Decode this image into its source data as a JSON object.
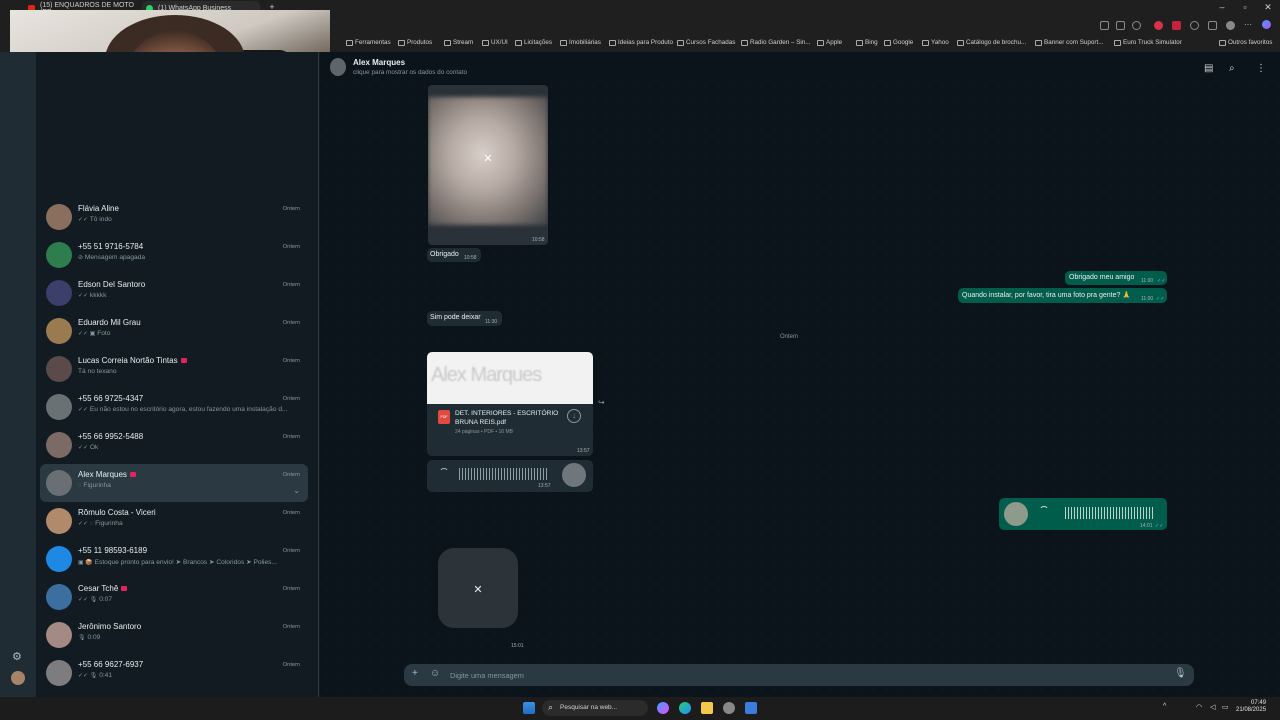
{
  "browser": {
    "tabs": [
      {
        "label": "(15) ENQUADROS DE MOTO (EF...",
        "color": "#e62117"
      },
      {
        "label": "(1) WhatsApp Business",
        "color": "#25d366"
      }
    ],
    "bookmarks": [
      "Ferramentas",
      "Produtos",
      "Stream",
      "UX/UI",
      "Licitações",
      "Imobiliárias",
      "Ideias para Produto",
      "Cursos Fachadas",
      "Radio Garden – Sin...",
      "Apple",
      "Bing",
      "Google",
      "Yahoo",
      "Catálogo de brochu...",
      "Banner com Suport...",
      "Euro Truck Simulator"
    ],
    "other_bookmarks": "Outros favoritos"
  },
  "chats": [
    {
      "name": "Flávia Aline",
      "preview": "Tô indo",
      "time": "Ontem",
      "ticks": "✓✓",
      "red": false
    },
    {
      "name": "+55 51 9716-5784",
      "preview": "Mensagem apagada",
      "time": "Ontem",
      "ticks": "⊘",
      "red": false
    },
    {
      "name": "Edson Del Santoro",
      "preview": "kkkkk",
      "time": "Ontem",
      "ticks": "✓✓",
      "red": false
    },
    {
      "name": "Eduardo Mil Grau",
      "preview": "Foto",
      "time": "Ontem",
      "ticks": "✓✓ ▣",
      "red": false
    },
    {
      "name": "Lucas Correia Nortão Tintas",
      "preview": "Tá no texano",
      "time": "Ontem",
      "ticks": "",
      "red": true
    },
    {
      "name": "+55 66 9725-4347",
      "preview": "Eu não estou no escritório agora, estou fazendo uma instalação d...",
      "time": "Ontem",
      "ticks": "✓✓",
      "red": false
    },
    {
      "name": "+55 66 9952-5488",
      "preview": "Ok",
      "time": "Ontem",
      "ticks": "✓✓",
      "red": false
    },
    {
      "name": "Alex Marques",
      "preview": "Figurinha",
      "time": "Ontem",
      "ticks": "◌",
      "red": true
    },
    {
      "name": "Rômulo Costa - Viceri",
      "preview": "Figurinha",
      "time": "Ontem",
      "ticks": "✓✓ ◌",
      "red": false
    },
    {
      "name": "+55 11 98593-6189",
      "preview": "Estoque pronto para envio! ➤ Brancos ➤ Coloridos ➤ Polies...",
      "time": "Ontem",
      "ticks": "▣ 📦",
      "red": false
    },
    {
      "name": "Cesar Tchê",
      "preview": "0:07",
      "time": "Ontem",
      "ticks": "✓✓ 🎙",
      "red": true
    },
    {
      "name": "Jerônimo Santoro",
      "preview": "0:09",
      "time": "Ontem",
      "ticks": "🎙",
      "red": false
    },
    {
      "name": "+55 66 9627-6937",
      "preview": "0:41",
      "time": "Ontem",
      "ticks": "✓✓ 🎙",
      "red": false
    }
  ],
  "chat_header": {
    "name": "Alex Marques",
    "subtitle": "clique para mostrar os dados do contato"
  },
  "messages": {
    "photo_time": "10:58",
    "obrigado": {
      "text": "Obrigado",
      "time": "10:58"
    },
    "out1": {
      "text": "Obrigado meu amigo",
      "time": "11:00"
    },
    "out2": {
      "text": "Quando instalar, por favor, tira uma foto pra gente? 🙏",
      "time": "11:00"
    },
    "sim": {
      "text": "Sim pode deixar",
      "time": "11:30"
    },
    "date_chip": "Ontem",
    "doc": {
      "preview": "Alex Marques",
      "name": "DET. INTERIORES - ESCRITÓRIO BRUNA REIS.pdf",
      "meta": "24 páginas • PDF • 16 MB",
      "time": "13:57",
      "icon": "PDF"
    },
    "audio_in_time": "13:57",
    "audio_out_time": "14:01",
    "sticker_time": "15:01"
  },
  "composer": {
    "placeholder": "Digite uma mensagem"
  },
  "taskbar": {
    "search_placeholder": "Pesquisar na web...",
    "time": "07:49",
    "date": "21/08/2025"
  }
}
